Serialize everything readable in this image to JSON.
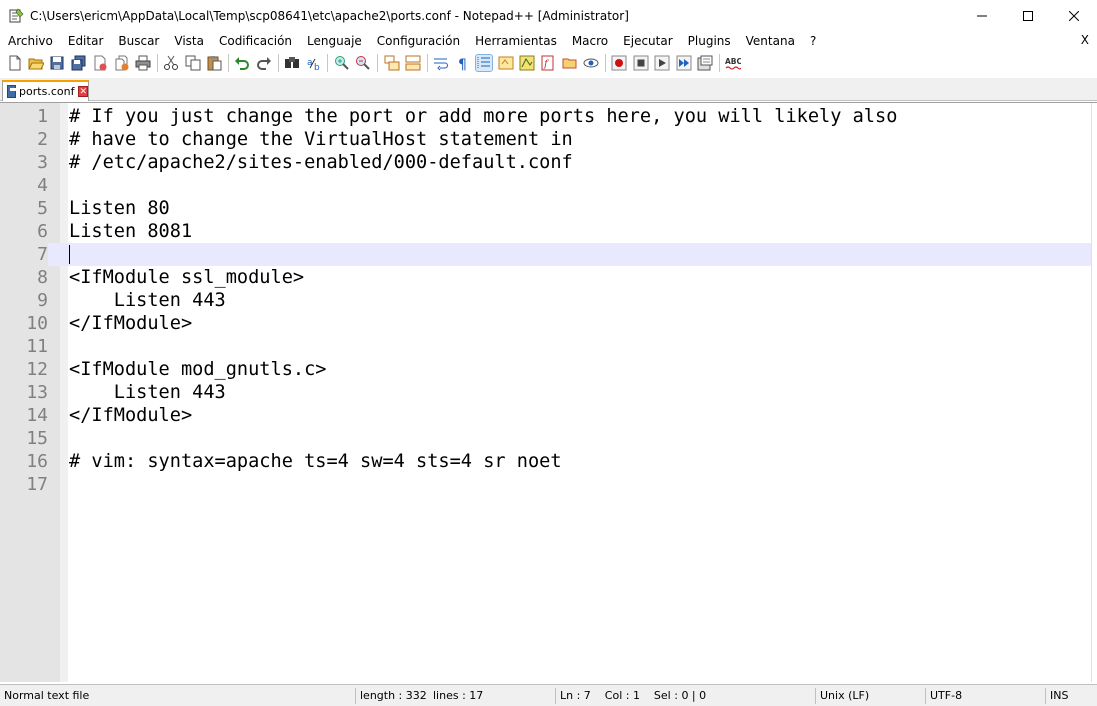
{
  "window": {
    "title": "C:\\Users\\ericm\\AppData\\Local\\Temp\\scp08641\\etc\\apache2\\ports.conf - Notepad++ [Administrator]",
    "minimize_glyph": "—",
    "maximize_glyph": "☐",
    "close_glyph": "✕"
  },
  "menu": {
    "items": [
      "Archivo",
      "Editar",
      "Buscar",
      "Vista",
      "Codificación",
      "Lenguaje",
      "Configuración",
      "Herramientas",
      "Macro",
      "Ejecutar",
      "Plugins",
      "Ventana",
      "?"
    ],
    "close_label": "X"
  },
  "toolbar": {
    "icons": [
      "new-file-icon",
      "open-file-icon",
      "save-icon",
      "save-all-icon",
      "close-icon",
      "close-all-icon",
      "print-icon",
      "cut-icon",
      "copy-icon",
      "paste-icon",
      "undo-icon",
      "redo-icon",
      "find-icon",
      "replace-icon",
      "zoom-in-icon",
      "zoom-out-icon",
      "sync-vertical-icon",
      "sync-horizontal-icon",
      "word-wrap-icon",
      "show-all-chars-icon",
      "indent-guide-icon",
      "udl-icon",
      "doc-map-icon",
      "function-list-icon",
      "folder-workspace-icon",
      "monitoring-icon",
      "record-macro-icon",
      "stop-macro-icon",
      "play-macro-icon",
      "run-macro-multiple-icon",
      "save-macro-icon",
      "spell-check-icon"
    ],
    "spell_label": "ABC"
  },
  "tabs": [
    {
      "label": "ports.conf",
      "close_glyph": "✕"
    }
  ],
  "editor": {
    "current_line": 7,
    "lines": [
      {
        "num": "1",
        "text": "# If you just change the port or add more ports here, you will likely also"
      },
      {
        "num": "2",
        "text": "# have to change the VirtualHost statement in"
      },
      {
        "num": "3",
        "text": "# /etc/apache2/sites-enabled/000-default.conf"
      },
      {
        "num": "4",
        "text": ""
      },
      {
        "num": "5",
        "text": "Listen 80"
      },
      {
        "num": "6",
        "text": "Listen 8081"
      },
      {
        "num": "7",
        "text": ""
      },
      {
        "num": "8",
        "text": "<IfModule ssl_module>"
      },
      {
        "num": "9",
        "text": "    Listen 443"
      },
      {
        "num": "10",
        "text": "</IfModule>"
      },
      {
        "num": "11",
        "text": ""
      },
      {
        "num": "12",
        "text": "<IfModule mod_gnutls.c>"
      },
      {
        "num": "13",
        "text": "    Listen 443"
      },
      {
        "num": "14",
        "text": "</IfModule>"
      },
      {
        "num": "15",
        "text": ""
      },
      {
        "num": "16",
        "text": "# vim: syntax=apache ts=4 sw=4 sts=4 sr noet"
      },
      {
        "num": "17",
        "text": ""
      }
    ]
  },
  "status": {
    "language": "Normal text file",
    "length": "length : 332",
    "lines": "lines : 17",
    "position": "Ln : 7    Col : 1    Sel : 0 | 0",
    "eol": "Unix (LF)",
    "encoding": "UTF-8",
    "mode": "INS"
  },
  "colors": {
    "tab_accent": "#f8a000",
    "current_line": "#e8e8ff",
    "gutter": "#e4e4e4",
    "line_number": "#808080"
  }
}
